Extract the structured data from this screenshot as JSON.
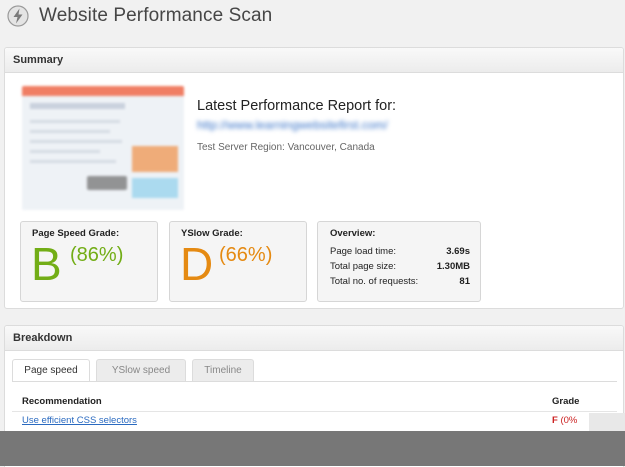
{
  "app": {
    "title": "Website Performance Scan",
    "logo_icon": "lightning-bolt-icon"
  },
  "summary": {
    "heading": "Summary",
    "report_title": "Latest Performance Report for:",
    "report_url": "http://www.learningwebsitefirst.com/",
    "region": "Test Server Region: Vancouver, Canada",
    "page_speed": {
      "label": "Page Speed Grade:",
      "letter": "B",
      "percent": "(86%)",
      "color": "#72ad16"
    },
    "yslow": {
      "label": "YSlow Grade:",
      "letter": "D",
      "percent": "(66%)",
      "color": "#e58a12"
    },
    "overview": {
      "title": "Overview:",
      "rows": [
        {
          "label": "Page load time:",
          "value": "3.69s"
        },
        {
          "label": "Total page size:",
          "value": "1.30MB"
        },
        {
          "label": "Total no. of requests:",
          "value": "81"
        }
      ]
    }
  },
  "breakdown": {
    "heading": "Breakdown",
    "tabs": [
      "Page speed",
      "YSlow speed",
      "Timeline"
    ],
    "active_tab": "Page speed",
    "columns": {
      "recommendation": "Recommendation",
      "grade": "Grade"
    },
    "rows": [
      {
        "recommendation": "Use efficient CSS selectors",
        "grade_letter": "F",
        "grade_pct": "(0%"
      }
    ]
  }
}
